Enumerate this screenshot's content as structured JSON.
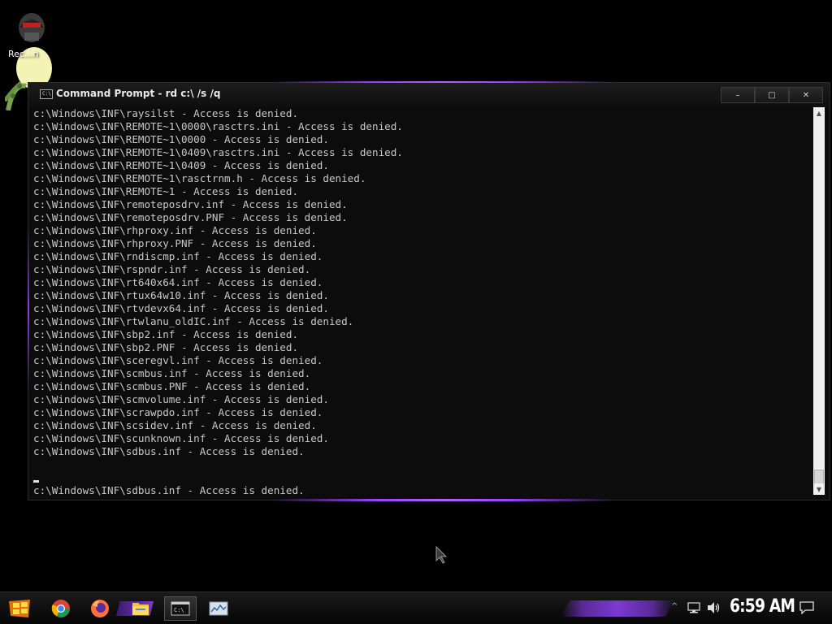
{
  "desktop": {
    "icon_label": "Rec...n"
  },
  "window": {
    "title": "Command Prompt - rd  c:\\ /s /q",
    "controls": {
      "minimize": "–",
      "maximize": "□",
      "close": "✕"
    },
    "console_lines": [
      "c:\\Windows\\INF\\raysilst - Access is denied.",
      "c:\\Windows\\INF\\REMOTE~1\\0000\\rasctrs.ini - Access is denied.",
      "c:\\Windows\\INF\\REMOTE~1\\0000 - Access is denied.",
      "c:\\Windows\\INF\\REMOTE~1\\0409\\rasctrs.ini - Access is denied.",
      "c:\\Windows\\INF\\REMOTE~1\\0409 - Access is denied.",
      "c:\\Windows\\INF\\REMOTE~1\\rasctrnm.h - Access is denied.",
      "c:\\Windows\\INF\\REMOTE~1 - Access is denied.",
      "c:\\Windows\\INF\\remoteposdrv.inf - Access is denied.",
      "c:\\Windows\\INF\\remoteposdrv.PNF - Access is denied.",
      "c:\\Windows\\INF\\rhproxy.inf - Access is denied.",
      "c:\\Windows\\INF\\rhproxy.PNF - Access is denied.",
      "c:\\Windows\\INF\\rndiscmp.inf - Access is denied.",
      "c:\\Windows\\INF\\rspndr.inf - Access is denied.",
      "c:\\Windows\\INF\\rt640x64.inf - Access is denied.",
      "c:\\Windows\\INF\\rtux64w10.inf - Access is denied.",
      "c:\\Windows\\INF\\rtvdevx64.inf - Access is denied.",
      "c:\\Windows\\INF\\rtwlanu_oldIC.inf - Access is denied.",
      "c:\\Windows\\INF\\sbp2.inf - Access is denied.",
      "c:\\Windows\\INF\\sbp2.PNF - Access is denied.",
      "c:\\Windows\\INF\\sceregvl.inf - Access is denied.",
      "c:\\Windows\\INF\\scmbus.inf - Access is denied.",
      "c:\\Windows\\INF\\scmbus.PNF - Access is denied.",
      "c:\\Windows\\INF\\scmvolume.inf - Access is denied.",
      "c:\\Windows\\INF\\scrawpdo.inf - Access is denied.",
      "c:\\Windows\\INF\\scsidev.inf - Access is denied.",
      "c:\\Windows\\INF\\scunknown.inf - Access is denied.",
      "c:\\Windows\\INF\\sdbus.inf - Access is denied.",
      "",
      "__CURSOR__",
      "c:\\Windows\\INF\\sdbus.inf - Access is denied.",
      "",
      "__CURSOR__"
    ]
  },
  "taskbar": {
    "items": [
      "start-icon",
      "chrome-icon",
      "firefox-icon",
      "file-explorer-icon",
      "command-prompt-icon",
      "task-manager-icon"
    ],
    "clock": "6:59 AM",
    "tray_chevron": "^"
  },
  "colors": {
    "accent": "#9a40ff",
    "console_text": "#c8c8c8",
    "background": "#000000"
  }
}
